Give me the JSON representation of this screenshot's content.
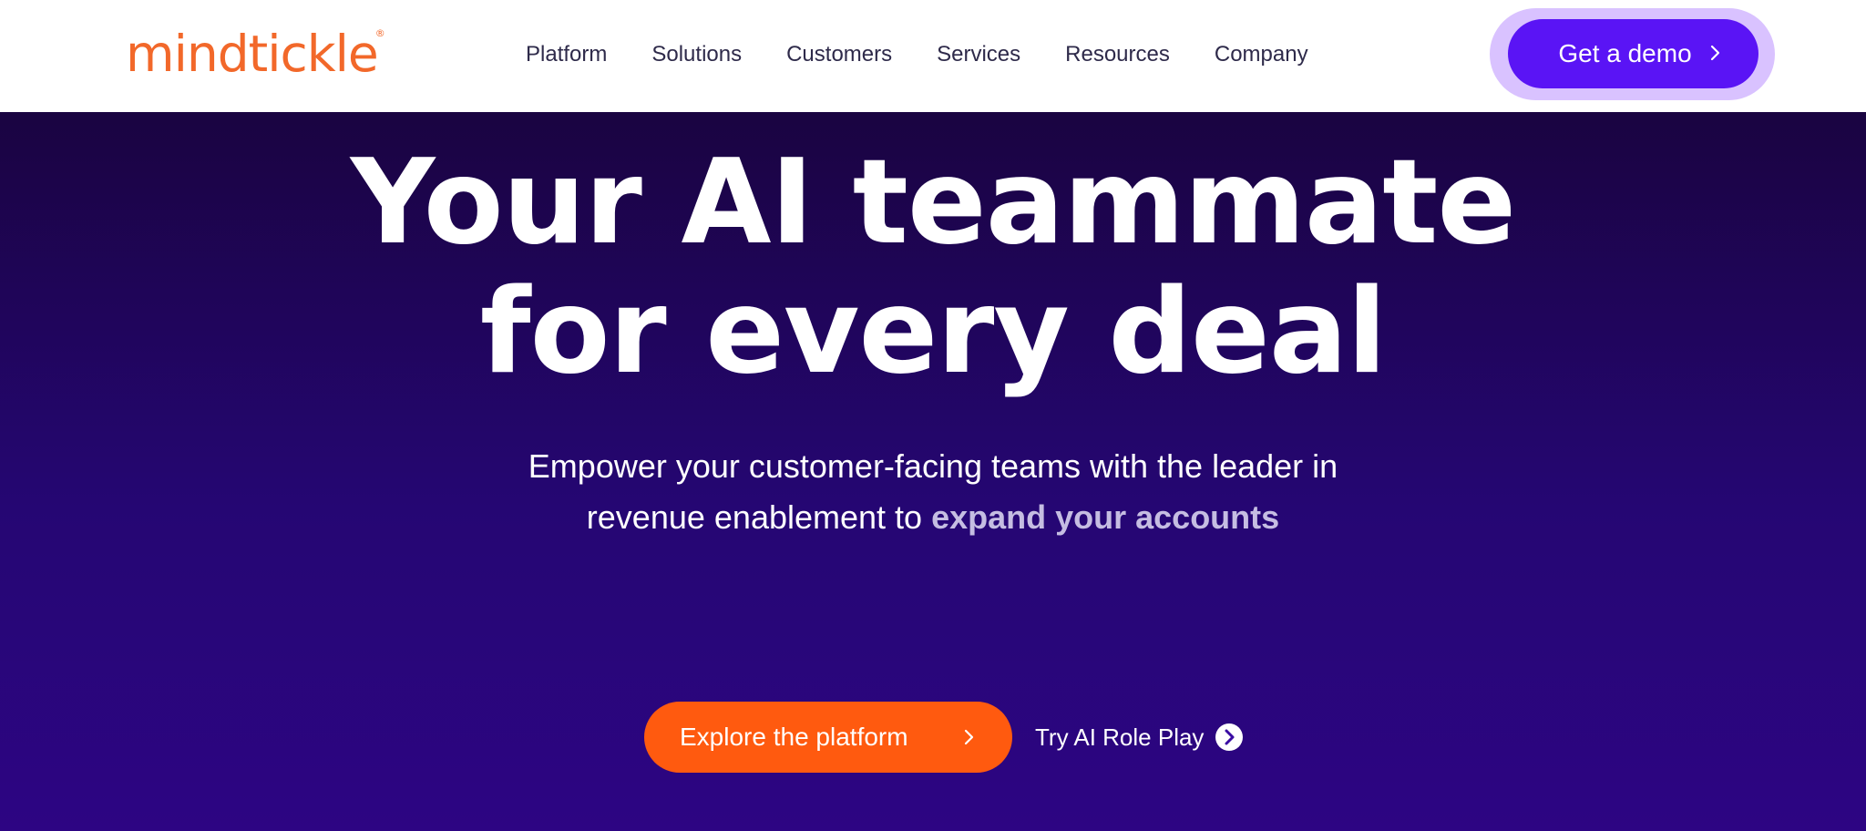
{
  "brand": {
    "logo_text": "mindtickle",
    "registered_mark": "®",
    "logo_color": "#f2682a"
  },
  "nav": {
    "items": [
      {
        "label": "Platform"
      },
      {
        "label": "Solutions"
      },
      {
        "label": "Customers"
      },
      {
        "label": "Services"
      },
      {
        "label": "Resources"
      },
      {
        "label": "Company"
      }
    ]
  },
  "header_cta": {
    "label": "Get a demo",
    "icon": "chevron-right-icon",
    "color": "#5a14f5",
    "halo_color": "#d9c2ff"
  },
  "hero": {
    "headline_line1": "Your AI teammate",
    "headline_line2": "for every deal",
    "subhead_line1": "Empower your customer-facing teams with the leader in",
    "subhead_line2_prefix": "revenue enablement to",
    "subhead_accent": "expand your accounts",
    "primary_cta": {
      "label": "Explore the platform",
      "icon": "chevron-right-icon",
      "color": "#ff5a0f"
    },
    "secondary_cta": {
      "label": "Try AI Role Play",
      "icon": "circle-chevron-right-icon"
    },
    "background_top": "#1a0441",
    "background_bottom": "#2d0583"
  }
}
